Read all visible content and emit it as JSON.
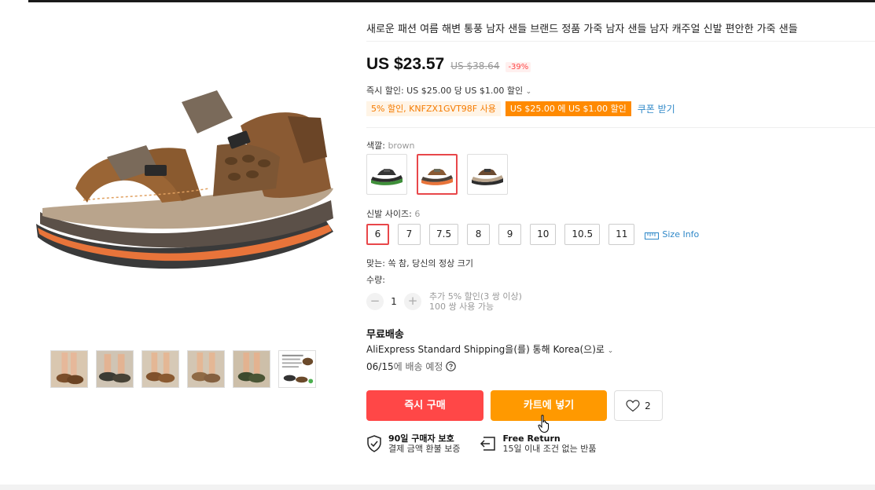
{
  "product": {
    "title": "새로운 패션 여름 해변 통풍 남자 샌들 브랜드 정품 가죽 남자 샌들 남자 캐주얼 신발 편안한 가죽 샌들",
    "price": "US $23.57",
    "old_price": "US $38.64",
    "discount": "-39%",
    "instant_discount": "즉시 할인: US $25.00 당 US $1.00 할인",
    "coupon_code_text": "5% 할인, KNFZX1GVT98F 사용",
    "coupon_deal_text": "US $25.00 에 US $1.00 할인",
    "coupon_link": "쿠폰 받기"
  },
  "color": {
    "label": "색깔:",
    "selected": "brown",
    "options": [
      "green",
      "brown",
      "khaki"
    ]
  },
  "size": {
    "label": "신발 사이즈:",
    "selected": "6",
    "options": [
      "6",
      "7",
      "7.5",
      "8",
      "9",
      "10",
      "10.5",
      "11"
    ],
    "info_link": "Size Info"
  },
  "fit": "맞는: 쏙 참, 당신의 정상 크기",
  "quantity": {
    "label": "수량:",
    "value": "1",
    "minus": "−",
    "plus": "+",
    "note_line1": "추가 5% 할인(3 쌍 이상)",
    "note_line2": "100 쌍 사용 가능"
  },
  "shipping": {
    "title": "무료배송",
    "method": "AliExpress Standard Shipping을(를) 통해 Korea(으)로",
    "date": "06/15",
    "date_suffix": "에 배송 예정"
  },
  "actions": {
    "buy_now": "즉시 구매",
    "add_to_cart": "카트에 넣기",
    "wishlist_count": "2"
  },
  "guarantees": [
    {
      "title": "90일 구매자 보호",
      "subtitle": "결제 금액 환불 보증"
    },
    {
      "title": "Free Return",
      "subtitle": "15일 이내 조건 없는 반품"
    }
  ],
  "colors": {
    "accent_red": "#ff4747",
    "accent_orange": "#ff9900",
    "link_blue": "#2f88c8"
  }
}
